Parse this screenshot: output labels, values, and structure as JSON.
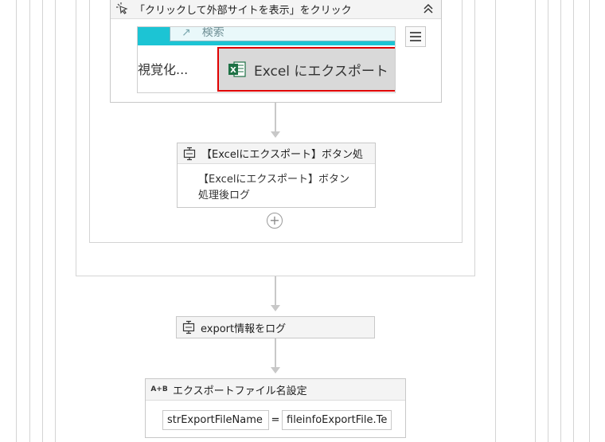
{
  "click_activity": {
    "title": "「クリックして外部サイトを表示」をクリック",
    "icon": "click-icon",
    "collapse_icon": "double-chevron-up-icon",
    "screenshot": {
      "search_text": "検索",
      "left_text": "視覚化...",
      "button_text": "Excel にエクスポート",
      "excel_icon_letter": "X",
      "highlight_color": "#e00000",
      "band_color": "#1cc4d4"
    },
    "menu_icon": "hamburger-menu-icon"
  },
  "log_activity_1": {
    "title": "【Excelにエクスポート】ボタン処",
    "icon": "log-message-icon",
    "message": "【Excelにエクスポート】ボタン処理後ログ"
  },
  "add_activity": {
    "icon": "add-circle-icon",
    "symbol": "+"
  },
  "log_activity_2": {
    "title": "export情報をログ",
    "icon": "log-message-icon"
  },
  "assign_activity": {
    "title": "エクスポートファイル名設定",
    "icon_text": "A+B",
    "target": "strExportFileName",
    "operator": "=",
    "value": "fileinfoExportFile.Te"
  }
}
